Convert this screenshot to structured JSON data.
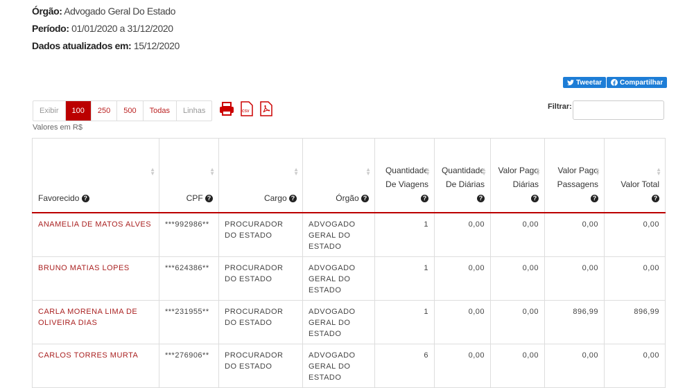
{
  "meta": {
    "orgao_label": "Órgão:",
    "orgao_value": "Advogado Geral Do Estado",
    "periodo_label": "Período:",
    "periodo_value": "01/01/2020 a 31/12/2020",
    "dados_label": "Dados atualizados em:",
    "dados_value": "15/12/2020"
  },
  "social": {
    "tweet": "Tweetar",
    "share": "Compartilhar"
  },
  "pager": {
    "exibir": "Exibir",
    "options": [
      "100",
      "250",
      "500",
      "Todas"
    ],
    "linhas": "Linhas",
    "selected": "100"
  },
  "icons": [
    "print-icon",
    "csv-icon",
    "pdf-icon"
  ],
  "csv_text": "csv",
  "filter": {
    "label": "Filtrar:"
  },
  "valores_note": "Valores em R$",
  "table": {
    "headers": [
      "Favorecido",
      "CPF",
      "Cargo",
      "Órgão",
      "Quantidade De Viagens",
      "Quantidade De Diárias",
      "Valor Pago Diárias",
      "Valor Pago Passagens",
      "Valor Total"
    ],
    "rows": [
      [
        "ANAMELIA DE MATOS ALVES",
        "***992986**",
        "PROCURADOR DO ESTADO",
        "ADVOGADO GERAL DO ESTADO",
        "1",
        "0,00",
        "0,00",
        "0,00",
        "0,00"
      ],
      [
        "BRUNO MATIAS LOPES",
        "***624386**",
        "PROCURADOR DO ESTADO",
        "ADVOGADO GERAL DO ESTADO",
        "1",
        "0,00",
        "0,00",
        "0,00",
        "0,00"
      ],
      [
        "CARLA MORENA LIMA DE OLIVEIRA DIAS",
        "***231955**",
        "PROCURADOR DO ESTADO",
        "ADVOGADO GERAL DO ESTADO",
        "1",
        "0,00",
        "0,00",
        "896,99",
        "896,99"
      ],
      [
        "CARLOS TORRES MURTA",
        "***276906**",
        "PROCURADOR DO ESTADO",
        "ADVOGADO GERAL DO ESTADO",
        "6",
        "0,00",
        "0,00",
        "0,00",
        "0,00"
      ]
    ]
  },
  "colors": {
    "accent": "#b00000",
    "link": "#a22222",
    "social": "#1d7dd6"
  }
}
